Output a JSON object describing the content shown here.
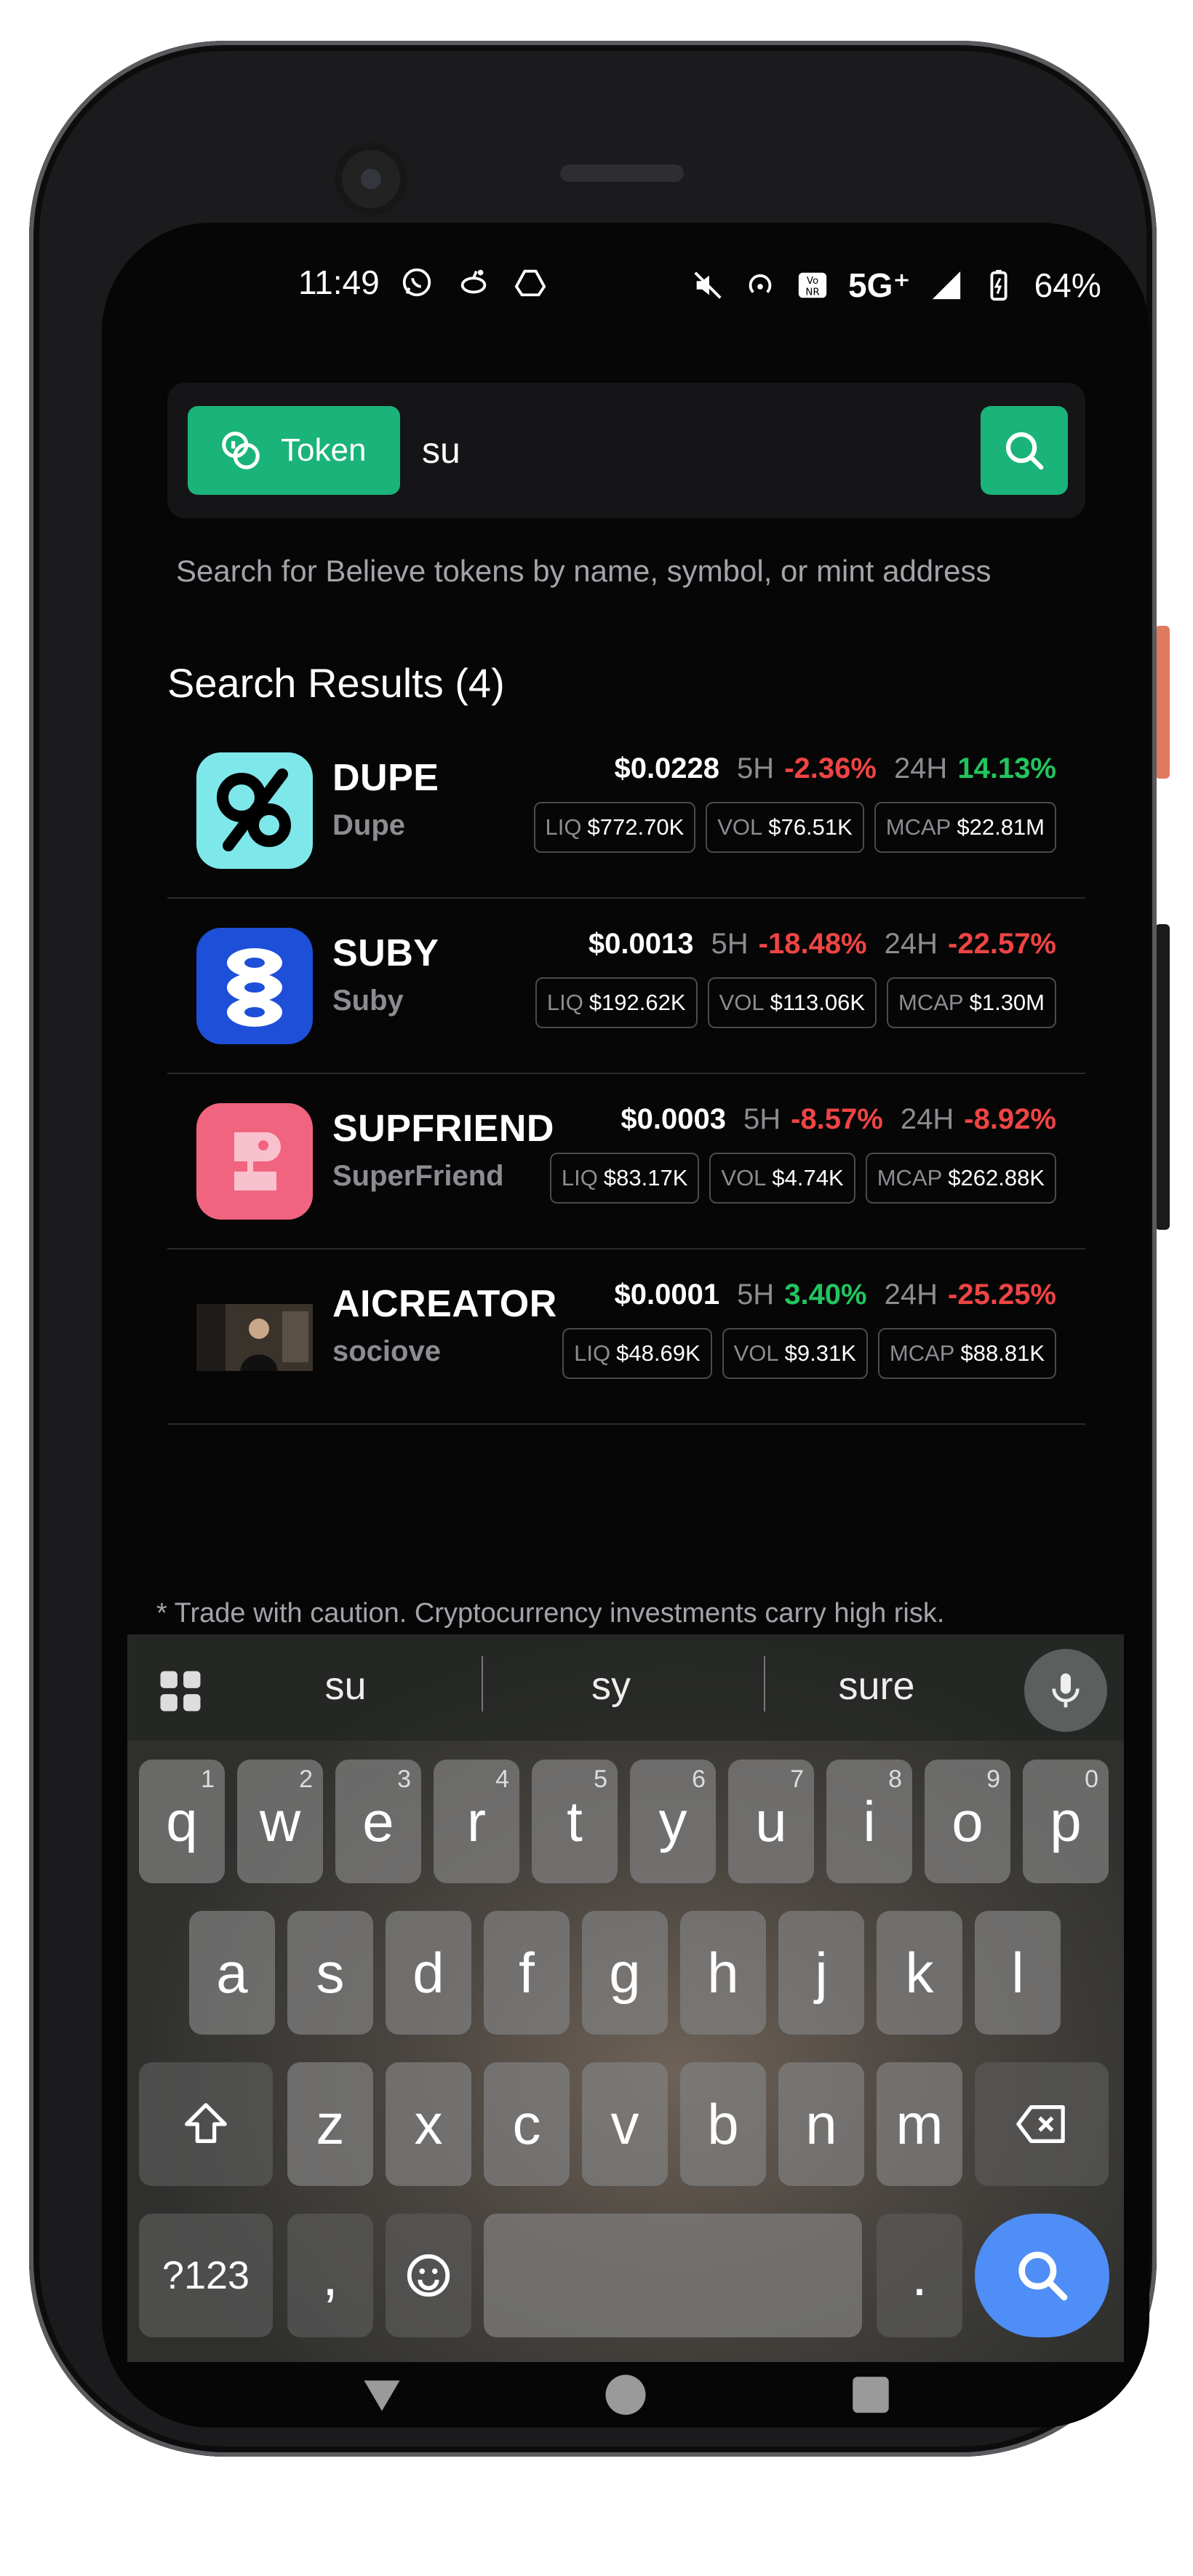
{
  "status_bar": {
    "time": "11:49",
    "left_icons": [
      "whatsapp-icon",
      "reddit-icon",
      "drive-icon"
    ],
    "network": "5G⁺",
    "volte": "Vo NR",
    "battery": "64%"
  },
  "search": {
    "mode_label": "Token",
    "query": "su",
    "hint": "Search for Believe tokens by name, symbol, or mint address"
  },
  "results": {
    "title": "Search Results (4)",
    "items": [
      {
        "symbol": "DUPE",
        "name": "Dupe",
        "price": "$0.0228",
        "h5_label": "5H",
        "h5": "-2.36%",
        "h5_dir": "neg",
        "h24_label": "24H",
        "h24": "14.13%",
        "h24_dir": "pos",
        "liq_label": "LIQ",
        "liq": "$772.70K",
        "vol_label": "VOL",
        "vol": "$76.51K",
        "mcap_label": "MCAP",
        "mcap": "$22.81M",
        "avatar_color": "#7ee7ea"
      },
      {
        "symbol": "SUBY",
        "name": "Suby",
        "price": "$0.0013",
        "h5_label": "5H",
        "h5": "-18.48%",
        "h5_dir": "neg",
        "h24_label": "24H",
        "h24": "-22.57%",
        "h24_dir": "neg",
        "liq_label": "LIQ",
        "liq": "$192.62K",
        "vol_label": "VOL",
        "vol": "$113.06K",
        "mcap_label": "MCAP",
        "mcap": "$1.30M",
        "avatar_color": "#1d4fd8"
      },
      {
        "symbol": "SUPFRIEND",
        "name": "SuperFriend",
        "price": "$0.0003",
        "h5_label": "5H",
        "h5": "-8.57%",
        "h5_dir": "neg",
        "h24_label": "24H",
        "h24": "-8.92%",
        "h24_dir": "neg",
        "liq_label": "LIQ",
        "liq": "$83.17K",
        "vol_label": "VOL",
        "vol": "$4.74K",
        "mcap_label": "MCAP",
        "mcap": "$262.88K",
        "avatar_color": "#f0647f"
      },
      {
        "symbol": "AICREATOR",
        "name": "sociove",
        "price": "$0.0001",
        "h5_label": "5H",
        "h5": "3.40%",
        "h5_dir": "pos",
        "h24_label": "24H",
        "h24": "-25.25%",
        "h24_dir": "neg",
        "liq_label": "LIQ",
        "liq": "$48.69K",
        "vol_label": "VOL",
        "vol": "$9.31K",
        "mcap_label": "MCAP",
        "mcap": "$88.81K",
        "avatar_color": "#2a2622"
      }
    ]
  },
  "disclaimer": "* Trade with caution. Cryptocurrency investments carry high risk.",
  "keyboard": {
    "suggestions": [
      "su",
      "sy",
      "sure"
    ],
    "row1": [
      {
        "k": "q",
        "n": "1"
      },
      {
        "k": "w",
        "n": "2"
      },
      {
        "k": "e",
        "n": "3"
      },
      {
        "k": "r",
        "n": "4"
      },
      {
        "k": "t",
        "n": "5"
      },
      {
        "k": "y",
        "n": "6"
      },
      {
        "k": "u",
        "n": "7"
      },
      {
        "k": "i",
        "n": "8"
      },
      {
        "k": "o",
        "n": "9"
      },
      {
        "k": "p",
        "n": "0"
      }
    ],
    "row2": [
      "a",
      "s",
      "d",
      "f",
      "g",
      "h",
      "j",
      "k",
      "l"
    ],
    "row3": [
      "z",
      "x",
      "c",
      "v",
      "b",
      "n",
      "m"
    ],
    "symbols_key": "?123",
    "comma_key": ",",
    "period_key": "."
  },
  "colors": {
    "accent": "#1ab37a",
    "positive": "#22c55e",
    "negative": "#ef4444",
    "enter": "#4f8ef7"
  }
}
